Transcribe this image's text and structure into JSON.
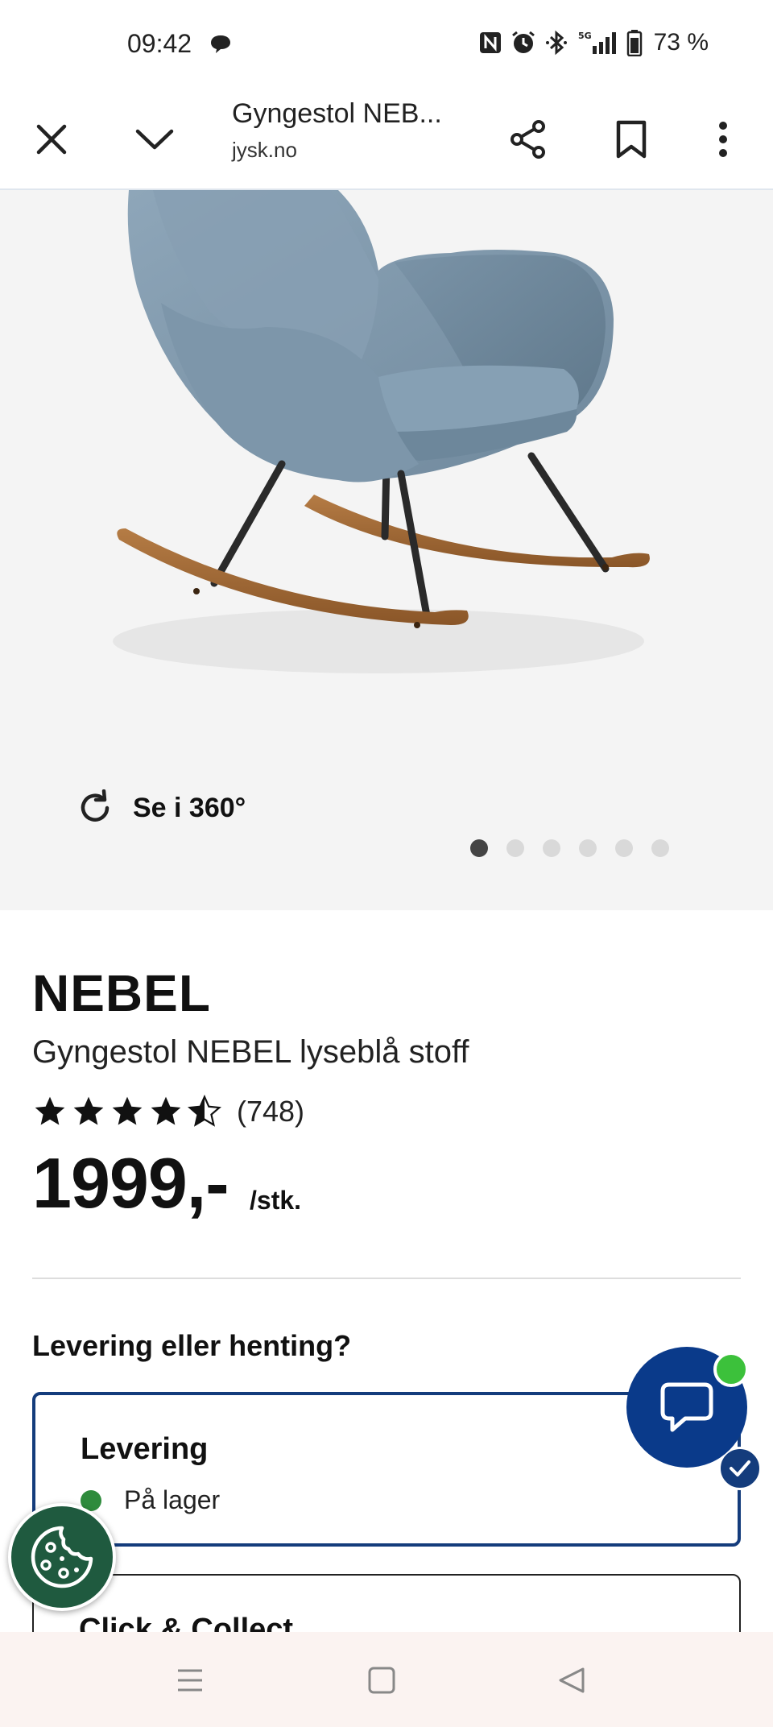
{
  "status_bar": {
    "time": "09:42",
    "battery": "73 %",
    "icons": [
      "chat-bubble-icon",
      "nfc-icon",
      "alarm-icon",
      "bluetooth-icon",
      "signal-5g-icon",
      "battery-icon"
    ]
  },
  "browser": {
    "tab_title": "Gyngestol NEB...",
    "domain": "jysk.no",
    "icons": [
      "close-icon",
      "chevron-down-icon",
      "share-icon",
      "bookmark-icon",
      "more-vertical-icon"
    ]
  },
  "gallery": {
    "view_360_label": "Se i 360°",
    "dot_count": 6,
    "active_dot": 0
  },
  "product": {
    "brand": "NEBEL",
    "name": "Gyngestol NEBEL lyseblå stoff",
    "rating_stars": 4.5,
    "rating_count": "(748)",
    "price": "1999,-",
    "price_unit": "/stk.",
    "colors": {
      "fabric": "#7f98ac",
      "wood": "#a8713e",
      "legs": "#2a2a2a"
    }
  },
  "delivery": {
    "heading": "Levering eller henting?",
    "options": [
      {
        "title": "Levering",
        "status": "På lager",
        "selected": true
      },
      {
        "title": "Click & Collect",
        "selected": false
      }
    ]
  },
  "colors": {
    "accent": "#143c7c",
    "chat": "#0a3a8a",
    "online": "#3cc13b",
    "in_stock": "#2e8b3c",
    "cookie": "#1f5a3f"
  }
}
